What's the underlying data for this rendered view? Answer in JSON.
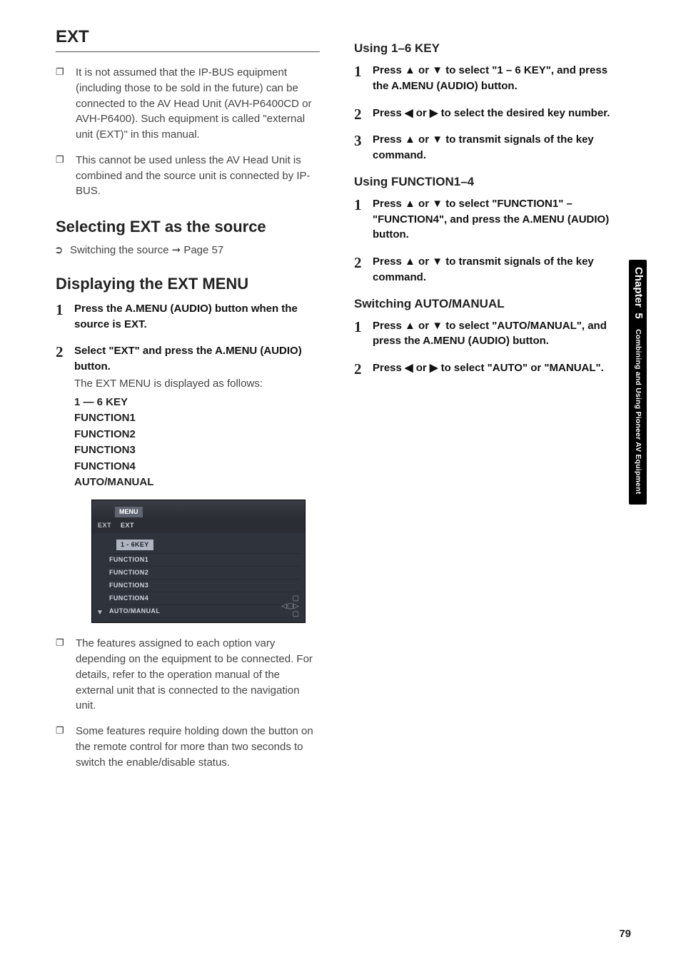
{
  "left": {
    "title": "EXT",
    "notes": [
      "It is not assumed that the IP-BUS equipment (including those to be sold in the future) can be connected to the AV Head Unit (AVH-P6400CD or AVH-P6400). Such equipment is called \"external unit (EXT)\" in this manual.",
      "This cannot be used unless the AV Head Unit is combined and the source unit is connected by IP-BUS."
    ],
    "sec1_heading": "Selecting EXT as the source",
    "sec1_ref_pre": "Switching the source",
    "sec1_ref_arrow": "➞",
    "sec1_ref_post": "Page 57",
    "sec2_heading": "Displaying the EXT MENU",
    "steps": [
      {
        "head": "Press the A.MENU (AUDIO) button when the source is EXT."
      },
      {
        "head": "Select \"EXT\" and press the A.MENU (AUDIO) button.",
        "body": "The EXT MENU is displayed as follows:",
        "menu": [
          "1 — 6 KEY",
          "FUNCTION1",
          "FUNCTION2",
          "FUNCTION3",
          "FUNCTION4",
          "AUTO/MANUAL"
        ]
      }
    ],
    "notes2": [
      "The features assigned to each option vary depending on the equipment to be connected. For details, refer to the operation manual of the external unit that is connected to the navigation unit.",
      "Some features require holding down the button on the remote control for more than two seconds to switch the enable/disable status."
    ],
    "screenshot": {
      "tab": "MENU",
      "src_label": "EXT",
      "src_value": "EXT",
      "rows": [
        "1 - 6KEY",
        "FUNCTION1",
        "FUNCTION2",
        "FUNCTION3",
        "FUNCTION4",
        "AUTO/MANUAL"
      ]
    }
  },
  "right": {
    "h1": "Using 1–6 KEY",
    "s1": [
      "Press ▲ or ▼ to select \"1 – 6 KEY\", and press the A.MENU (AUDIO) button.",
      "Press ◀ or ▶ to select the desired key number.",
      "Press ▲ or ▼ to transmit signals of the key command."
    ],
    "h2": "Using FUNCTION1–4",
    "s2": [
      "Press ▲ or ▼ to select \"FUNCTION1\" – \"FUNCTION4\", and press the A.MENU (AUDIO) button.",
      "Press ▲ or ▼ to transmit signals of the key command."
    ],
    "h3": "Switching AUTO/MANUAL",
    "s3": [
      "Press ▲ or ▼ to select \"AUTO/MANUAL\", and press the A.MENU (AUDIO) button.",
      "Press ◀ or ▶ to select \"AUTO\" or \"MANUAL\"."
    ]
  },
  "sidetab": {
    "chapter_label": "Chapter",
    "chapter_num": "5",
    "chapter_text": "Combining and Using Pioneer AV Equipment"
  },
  "page_number": "79"
}
